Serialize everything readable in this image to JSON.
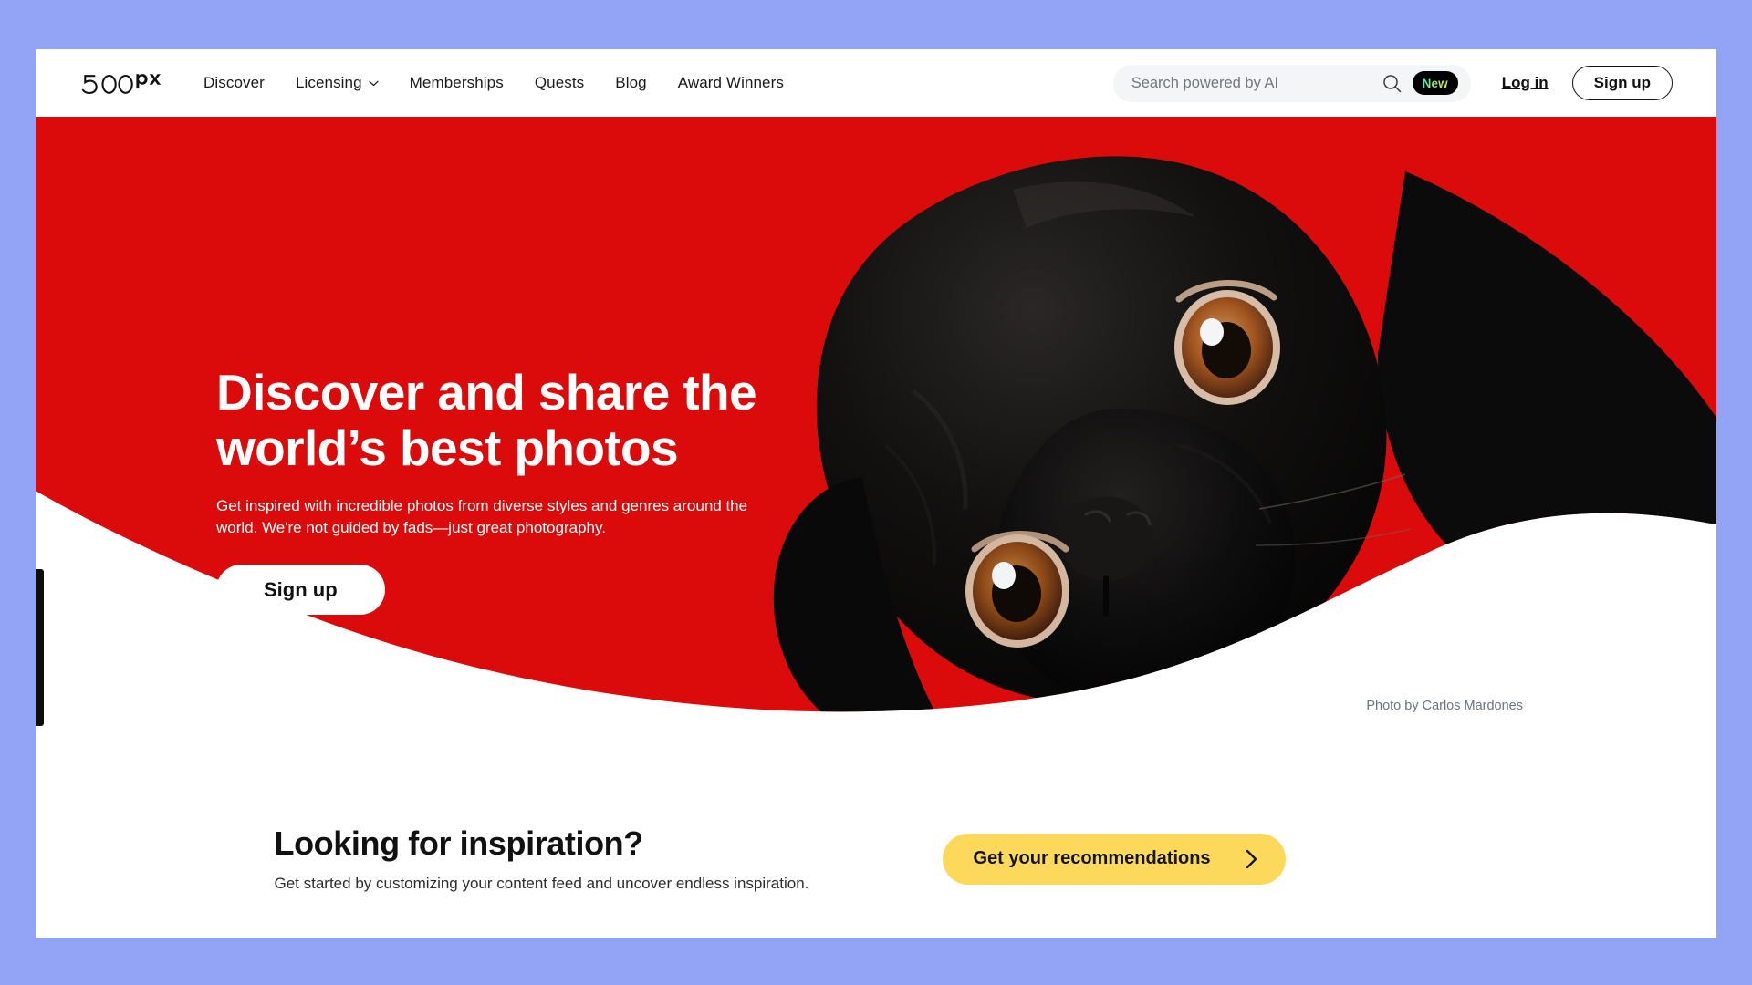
{
  "theme": {
    "page_background": "#93a4f6",
    "hero_red": "#dc0b0b",
    "accent_yellow": "#fcd95b",
    "badge_background": "#000000",
    "search_background": "#f4f5f7"
  },
  "header": {
    "logo_label": "500px",
    "nav": [
      {
        "label": "Discover",
        "has_caret": false
      },
      {
        "label": "Licensing",
        "has_caret": true
      },
      {
        "label": "Memberships",
        "has_caret": false
      },
      {
        "label": "Quests",
        "has_caret": false
      },
      {
        "label": "Blog",
        "has_caret": false
      },
      {
        "label": "Award Winners",
        "has_caret": false
      }
    ],
    "search": {
      "value": "",
      "placeholder": "Search powered by AI",
      "icon": "search-icon"
    },
    "new_badge": "New",
    "login_label": "Log in",
    "signup_label": "Sign up"
  },
  "hero": {
    "title_line_1": "Discover and share the",
    "title_line_2": "world’s best photos",
    "subtitle": "Get inspired with incredible photos from diverse styles and genres around the world. We're not guided by fads—just great photography.",
    "cta_label": "Sign up",
    "photo_credit": "Photo by Carlos Mardones"
  },
  "inspiration": {
    "title": "Looking for inspiration?",
    "subtitle": "Get started by customizing your content feed and uncover endless inspiration.",
    "cta_label": "Get your recommendations",
    "cta_icon": "chevron-right-icon"
  }
}
